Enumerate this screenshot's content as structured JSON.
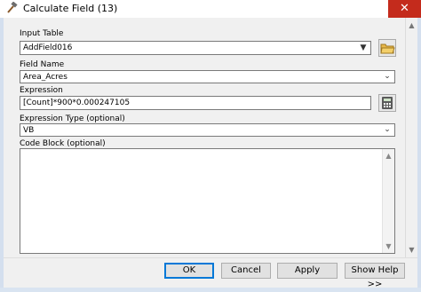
{
  "window": {
    "title": "Calculate Field (13)",
    "close_glyph": "✕"
  },
  "form": {
    "input_table": {
      "label": "Input Table",
      "value": "AddField016"
    },
    "field_name": {
      "label": "Field Name",
      "value": "Area_Acres"
    },
    "expression": {
      "label": "Expression",
      "value": "[Count]*900*0.000247105"
    },
    "expression_type": {
      "label": "Expression Type (optional)",
      "value": "VB"
    },
    "code_block": {
      "label": "Code Block (optional)",
      "value": ""
    }
  },
  "footer": {
    "ok_label": "OK",
    "cancel_label": "Cancel",
    "apply_label": "Apply",
    "show_help_label": "Show Help >>"
  },
  "icons": {
    "title_icon": "hammer-icon",
    "browse_icon": "open-folder-icon",
    "calculator_icon": "calculator-icon"
  },
  "colors": {
    "close_button": "#c42b1c",
    "window_frame": "#d9e4f1",
    "dialog_background": "#f0f0f0",
    "default_button_border": "#0078d7"
  }
}
